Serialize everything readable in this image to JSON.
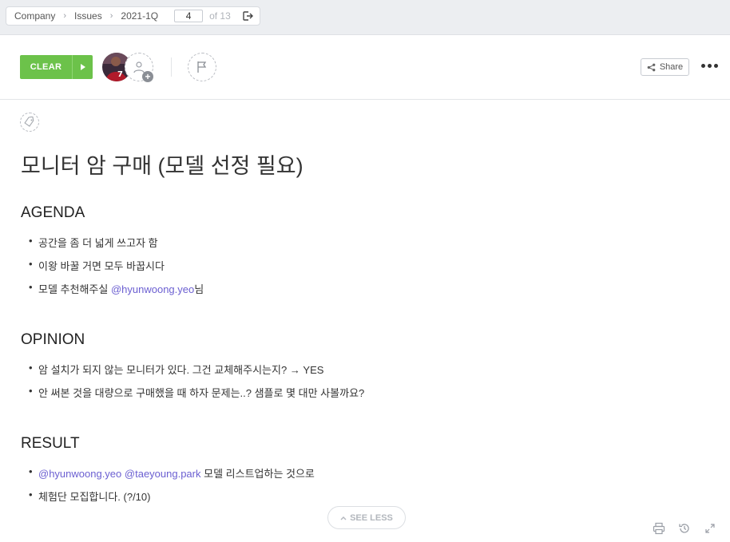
{
  "breadcrumb": {
    "items": [
      "Company",
      "Issues",
      "2021-1Q"
    ],
    "page_number": "4",
    "of_total": "of 13"
  },
  "toolbar": {
    "status_label": "CLEAR",
    "status_color": "#6cc24a",
    "share_label": "Share"
  },
  "document": {
    "title": "모니터 암 구매 (모델 선정 필요)",
    "sections": [
      {
        "heading": "AGENDA",
        "items": [
          {
            "text": "공간을 좀 더 넓게 쓰고자 함"
          },
          {
            "text": "이왕 바꿀 거면 모두 바꿉시다"
          },
          {
            "prefix": "모델 추천해주실 ",
            "mention": "@hyunwoong.yeo",
            "suffix": "님"
          }
        ]
      },
      {
        "heading": "OPINION",
        "items": [
          {
            "text": "암 설치가 되지 않는 모니터가 있다. 그건 교체해주시는지? → YES"
          },
          {
            "text": "안 써본 것을 대량으로 구매했을 때 하자 문제는..? 샘플로 몇 대만 사볼까요?"
          }
        ]
      },
      {
        "heading": "RESULT",
        "items": [
          {
            "mention1": "@hyunwoong.yeo",
            "mention2": "@taeyoung.park",
            "suffix": " 모델 리스트업하는 것으로"
          },
          {
            "text": "체험단 모집합니다. (?/10)"
          }
        ]
      }
    ]
  },
  "see_less_label": "SEE LESS",
  "accent_mention_color": "#6b5fd1"
}
